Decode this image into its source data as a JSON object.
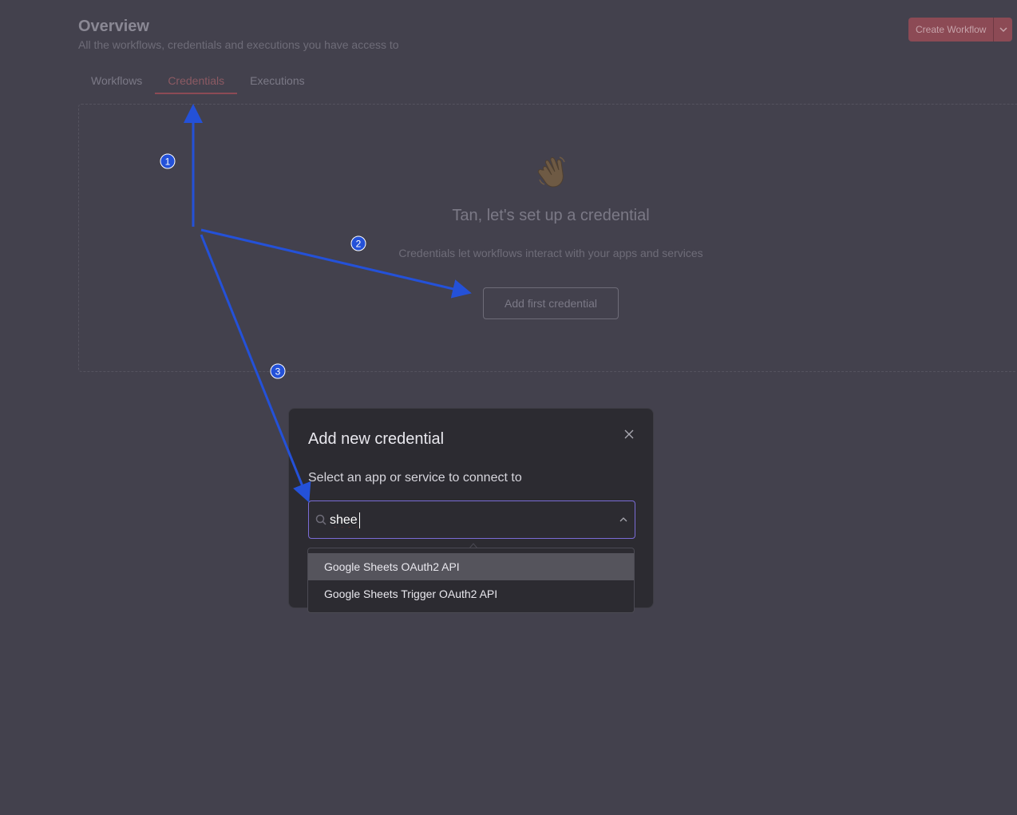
{
  "header": {
    "title": "Overview",
    "subtitle": "All the workflows, credentials and executions you have access to",
    "create_button_label": "Create Workflow"
  },
  "tabs": [
    {
      "label": "Workflows",
      "active": false
    },
    {
      "label": "Credentials",
      "active": true
    },
    {
      "label": "Executions",
      "active": false
    }
  ],
  "empty_state": {
    "icon": "waving-hand-icon",
    "heading": "Tan, let's set up a credential",
    "description": "Credentials let workflows interact with your apps and services",
    "button_label": "Add first credential"
  },
  "modal": {
    "title": "Add new credential",
    "label": "Select an app or service to connect to",
    "search": {
      "value": "shee",
      "placeholder": ""
    },
    "options": [
      {
        "label": "Google Sheets OAuth2 API",
        "highlighted": true
      },
      {
        "label": "Google Sheets Trigger OAuth2 API",
        "highlighted": false
      }
    ]
  },
  "annotations": {
    "steps": [
      "1",
      "2",
      "3"
    ],
    "color": "#2451d8"
  },
  "colors": {
    "accent": "#7a6cd6",
    "brand_button": "#8c4a55",
    "background": "#43414d",
    "modal_background": "#2c2b31"
  }
}
